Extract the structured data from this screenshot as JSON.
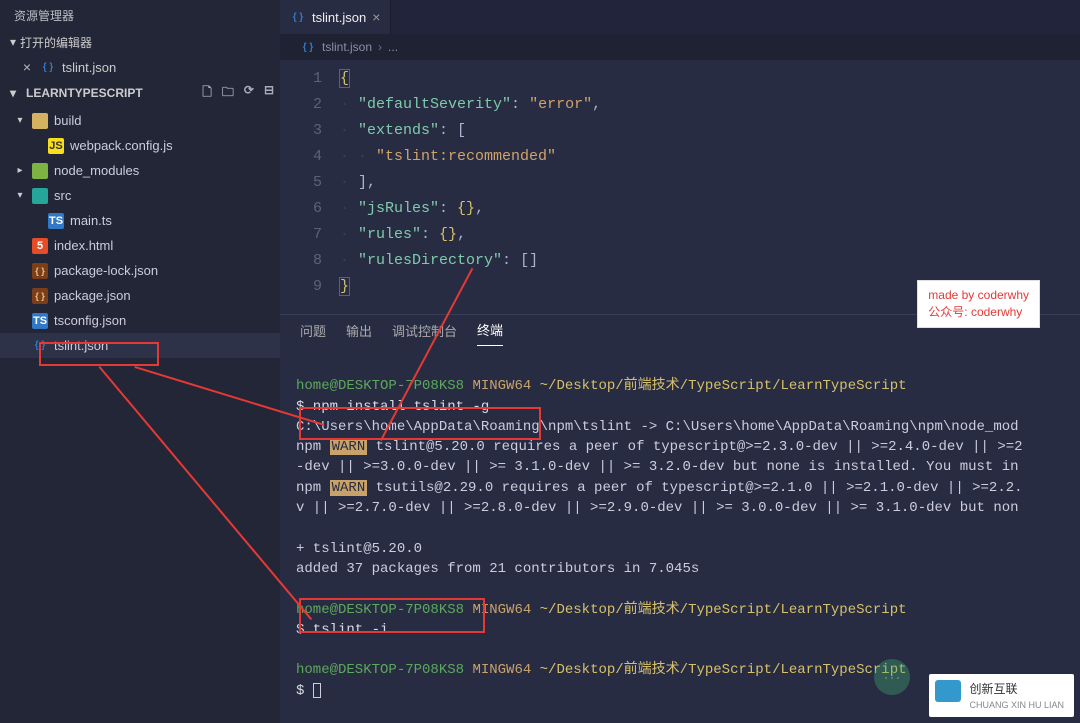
{
  "sidebar": {
    "title": "资源管理器",
    "openEditorsLabel": "打开的编辑器",
    "openEditorFile": "tslint.json",
    "project": "LEARNTYPESCRIPT",
    "tree": [
      {
        "indent": 0,
        "chev": "▾",
        "icon": "ic-folder",
        "label": "build"
      },
      {
        "indent": 1,
        "chev": "",
        "icon": "ic-js",
        "iconTxt": "JS",
        "label": "webpack.config.js"
      },
      {
        "indent": 0,
        "chev": "▸",
        "icon": "ic-folder-g",
        "label": "node_modules"
      },
      {
        "indent": 0,
        "chev": "▾",
        "icon": "ic-folder-t",
        "label": "src"
      },
      {
        "indent": 1,
        "chev": "",
        "icon": "ic-ts",
        "iconTxt": "TS",
        "label": "main.ts"
      },
      {
        "indent": 0,
        "chev": "",
        "icon": "ic-html",
        "iconTxt": "5",
        "label": "index.html"
      },
      {
        "indent": 0,
        "chev": "",
        "icon": "ic-json",
        "iconTxt": "{ }",
        "label": "package-lock.json"
      },
      {
        "indent": 0,
        "chev": "",
        "icon": "ic-json",
        "iconTxt": "{ }",
        "label": "package.json"
      },
      {
        "indent": 0,
        "chev": "",
        "icon": "ic-ts",
        "iconTxt": "TS",
        "label": "tsconfig.json"
      },
      {
        "indent": 0,
        "chev": "",
        "icon": "ic-tslint",
        "iconTxt": "{ }",
        "label": "tslint.json",
        "selected": true
      }
    ]
  },
  "tab": {
    "icon": "{ }",
    "label": "tslint.json"
  },
  "breadcrumb": {
    "file": "tslint.json",
    "sep": "›",
    "dots": "..."
  },
  "code": {
    "lines": [
      "1",
      "2",
      "3",
      "4",
      "5",
      "6",
      "7",
      "8",
      "9"
    ],
    "l1": "{",
    "l2_key": "\"defaultSeverity\"",
    "l2_val": "\"error\"",
    "l3_key": "\"extends\"",
    "l4_val": "\"tslint:recommended\"",
    "l6_key": "\"jsRules\"",
    "l7_key": "\"rules\"",
    "l8_key": "\"rulesDirectory\"",
    "l9": "}"
  },
  "watermark": {
    "line1": "made by coderwhy",
    "line2": "公众号: coderwhy"
  },
  "panel": {
    "tabs": [
      "问题",
      "输出",
      "调试控制台",
      "终端"
    ],
    "active": 3
  },
  "terminal": {
    "user": "home@DESKTOP-7P08KS8",
    "shell": "MINGW64",
    "path": "~/Desktop/前端技术/TypeScript/LearnTypeScript",
    "cmd1": "$ npm install tslint -g",
    "l1": "C:\\Users\\home\\AppData\\Roaming\\npm\\tslint -> C:\\Users\\home\\AppData\\Roaming\\npm\\node_mod",
    "warn": "WARN",
    "l2a": "npm ",
    "l2b": " tslint@5.20.0 requires a peer of typescript@>=2.3.0-dev || >=2.4.0-dev || >=2",
    "l3": "-dev || >=3.0.0-dev || >= 3.1.0-dev || >= 3.2.0-dev but none is installed. You must in",
    "l4a": "npm ",
    "l4b": " tsutils@2.29.0 requires a peer of typescript@>=2.1.0 || >=2.1.0-dev || >=2.2.",
    "l5": "v || >=2.7.0-dev || >=2.8.0-dev || >=2.9.0-dev || >= 3.0.0-dev || >= 3.1.0-dev but non",
    "l6": "+ tslint@5.20.0",
    "l7": "added 37 packages from 21 contributors in 7.045s",
    "cmd2": "$ tslint -i",
    "path3": "~/Desktop/前端技术/TypeScript/LearnTypeScript",
    "prompt3": "$ "
  },
  "logo": "创新互联"
}
